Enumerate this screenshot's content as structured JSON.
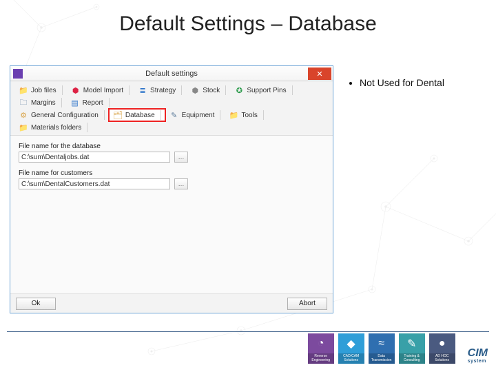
{
  "slide": {
    "title": "Default Settings – Database",
    "bullet": "Not Used for Dental"
  },
  "dialog": {
    "title": "Default settings",
    "close_glyph": "✕",
    "tabs_row1": [
      {
        "icon": "📁",
        "cls": "ico-folder",
        "name": "tab-job-files",
        "label": "Job files"
      },
      {
        "icon": "⬢",
        "cls": "ico-red",
        "name": "tab-model-import",
        "label": "Model Import"
      },
      {
        "icon": "≣",
        "cls": "ico-blue",
        "name": "tab-strategy",
        "label": "Strategy"
      },
      {
        "icon": "⬢",
        "cls": "ico-cyl",
        "name": "tab-stock",
        "label": "Stock"
      },
      {
        "icon": "✪",
        "cls": "ico-green",
        "name": "tab-support-pins",
        "label": "Support Pins"
      },
      {
        "icon": "🗀",
        "cls": "ico-steel",
        "name": "tab-margins",
        "label": "Margins"
      },
      {
        "icon": "▤",
        "cls": "ico-blue",
        "name": "tab-report",
        "label": "Report"
      }
    ],
    "tabs_row2": [
      {
        "icon": "⚙",
        "cls": "ico-gear",
        "name": "tab-general-config",
        "label": "General Configuration"
      },
      {
        "icon": "🗂",
        "cls": "ico-folder",
        "name": "tab-database",
        "label": "Database",
        "selected": true
      },
      {
        "icon": "✎",
        "cls": "ico-steel",
        "name": "tab-equipment",
        "label": "Equipment"
      },
      {
        "icon": "📁",
        "cls": "ico-folder",
        "name": "tab-tools",
        "label": "Tools"
      },
      {
        "icon": "📁",
        "cls": "ico-folder",
        "name": "tab-materials",
        "label": "Materials folders"
      }
    ],
    "fields": {
      "db_label": "File name for the database",
      "db_value": "C:\\sum\\Dentaljobs.dat",
      "cust_label": "File name for customers",
      "cust_value": "C:\\sum\\DentalCustomers.dat",
      "browse_glyph": "…"
    },
    "buttons": {
      "ok": "Ok",
      "abort": "Abort"
    }
  },
  "footer": {
    "tiles": [
      {
        "cls": "t1",
        "icon": "◔",
        "label": "Reverse Engineering"
      },
      {
        "cls": "t2",
        "icon": "◆",
        "label": "CAD/CAM Solutions"
      },
      {
        "cls": "t3",
        "icon": "≈",
        "label": "Data Transmission"
      },
      {
        "cls": "t4",
        "icon": "✎",
        "label": "Training & Consulting"
      },
      {
        "cls": "t5",
        "icon": "●",
        "label": "AD HOC Solutions"
      }
    ],
    "brand": "CIM",
    "brand_sub": "system"
  }
}
